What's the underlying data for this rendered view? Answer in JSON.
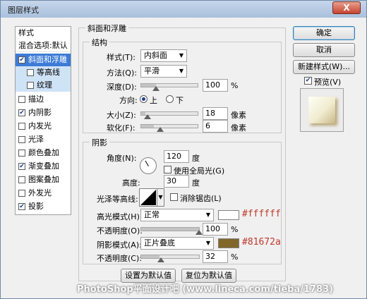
{
  "window": {
    "title": "图层样式",
    "close": "X"
  },
  "left_list": {
    "header": "样式",
    "blend": "混合选项:默认",
    "items": [
      {
        "label": "斜面和浮雕",
        "checked": true
      },
      {
        "label": "等高线",
        "checked": false
      },
      {
        "label": "纹理",
        "checked": false
      },
      {
        "label": "描边",
        "checked": false
      },
      {
        "label": "内阴影",
        "checked": true
      },
      {
        "label": "内发光",
        "checked": false
      },
      {
        "label": "光泽",
        "checked": false
      },
      {
        "label": "颜色叠加",
        "checked": false
      },
      {
        "label": "渐变叠加",
        "checked": true
      },
      {
        "label": "图案叠加",
        "checked": false
      },
      {
        "label": "外发光",
        "checked": false
      },
      {
        "label": "投影",
        "checked": true
      }
    ],
    "check_mark": "✔"
  },
  "bevel": {
    "title": "斜面和浮雕",
    "structure": {
      "title": "结构",
      "style_label": "样式(T):",
      "style_value": "内斜面",
      "technique_label": "方法(Q):",
      "technique_value": "平滑",
      "depth_label": "深度(D):",
      "depth_value": "100",
      "depth_unit": "%",
      "direction_label": "方向:",
      "dir_up": "上",
      "dir_down": "下",
      "size_label": "大小(Z):",
      "size_value": "18",
      "size_unit": "像素",
      "soften_label": "软化(F):",
      "soften_value": "6",
      "soften_unit": "像素"
    },
    "shading": {
      "title": "阴影",
      "angle_label": "角度(N):",
      "angle_value": "120",
      "angle_unit": "度",
      "global_light": "使用全局光(G)",
      "altitude_label": "高度:",
      "altitude_value": "30",
      "altitude_unit": "度",
      "contour_label": "光泽等高线:",
      "anti_alias": "消除锯齿(L)",
      "highlight_label": "高光模式(H):",
      "highlight_mode": "正常",
      "highlight_color": "#ffffff",
      "highlight_hex": "#ffffff",
      "highlight_opacity_label": "不透明度(O):",
      "highlight_opacity_value": "100",
      "highlight_opacity_unit": "%",
      "shadow_label": "阴影模式(A):",
      "shadow_mode": "正片叠底",
      "shadow_color": "#81672a",
      "shadow_hex": "#81672a",
      "shadow_opacity_label": "不透明度(C):",
      "shadow_opacity_value": "32",
      "shadow_opacity_unit": "%"
    },
    "make_default": "设置为默认值",
    "reset_default": "复位为默认值"
  },
  "right_buttons": {
    "ok": "确定",
    "cancel": "取消",
    "new_style": "新建样式(W)...",
    "preview_label": "预览(V)"
  },
  "watermark": "PhotoShop平面设计吧 (www.lineca.com/tieba/1783)",
  "levels": {
    "depth_pct": 0.26,
    "size_pct": 0.08,
    "soften_pct": 0.22,
    "highlight_opacity_pct": 1.0,
    "shadow_opacity_pct": 0.32
  }
}
